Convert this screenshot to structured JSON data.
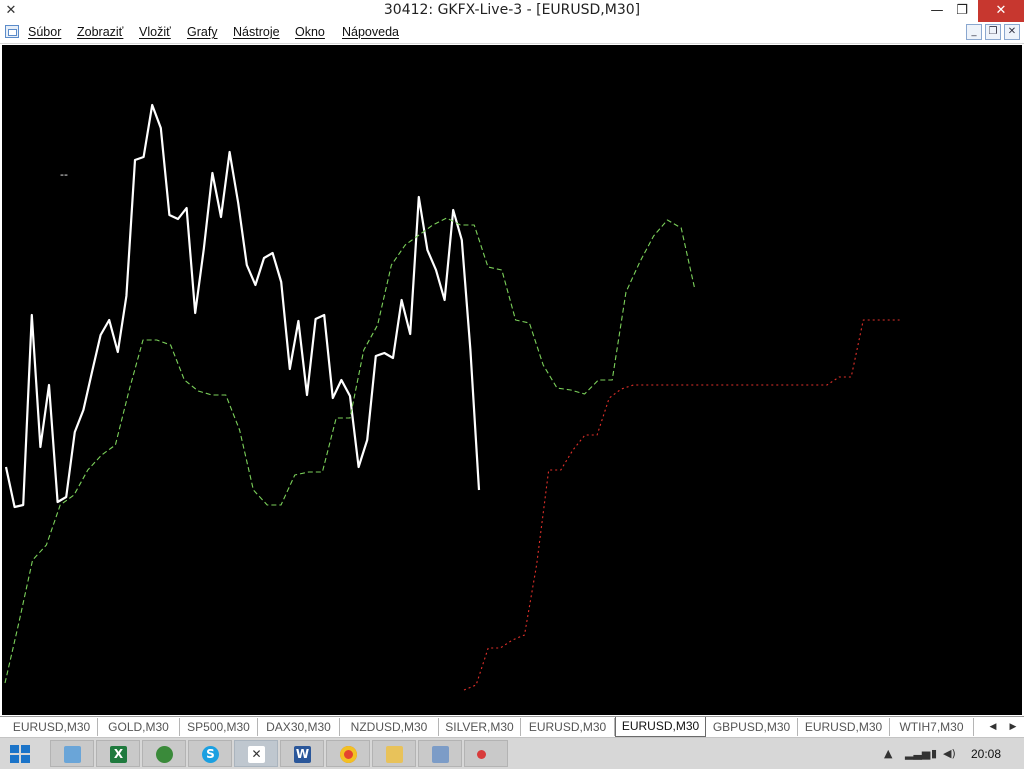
{
  "window": {
    "title": "30412: GKFX-Live-3 - [EURUSD,M30]",
    "minimize_icon": "minimize-icon",
    "maximize_icon": "restore-icon",
    "close_icon": "close-icon"
  },
  "menu": {
    "items": [
      {
        "label": "Súbor"
      },
      {
        "label": "Zobraziť"
      },
      {
        "label": "Vložiť"
      },
      {
        "label": "Grafy"
      },
      {
        "label": "Nástroje"
      },
      {
        "label": "Okno"
      },
      {
        "label": "Nápoveda"
      }
    ]
  },
  "chart": {
    "background": "#000000",
    "colors": {
      "price": "#ffffff",
      "green": "#7bd05a",
      "red": "#e0302a"
    },
    "marker_label": "--"
  },
  "chart_data": {
    "type": "line",
    "series": [
      {
        "style": "solid",
        "color": "#ffffff",
        "values": [
          467,
          507,
          505,
          315,
          447,
          385,
          502,
          497,
          432,
          410,
          372,
          335,
          320,
          352,
          296,
          160,
          157,
          105,
          128,
          215,
          219,
          208,
          313,
          249,
          173,
          217,
          152,
          203,
          265,
          285,
          258,
          253,
          282,
          369,
          321,
          395,
          319,
          315,
          398,
          380,
          396,
          467,
          440,
          356,
          353,
          358,
          300,
          334,
          197,
          250,
          270,
          300,
          210,
          240,
          350,
          490
        ]
      },
      {
        "style": "dashed",
        "color": "#7bd05a",
        "values": [
          683,
          623,
          560,
          545,
          505,
          495,
          470,
          455,
          445,
          390,
          340,
          340,
          345,
          380,
          391,
          395,
          395,
          430,
          490,
          505,
          505,
          475,
          472,
          472,
          418,
          418,
          350,
          325,
          265,
          245,
          235,
          225,
          218,
          225,
          225,
          267,
          270,
          320,
          323,
          365,
          388,
          390,
          394,
          380,
          380,
          292,
          262,
          236,
          220,
          228,
          290
        ]
      },
      {
        "style": "dashed",
        "color": "#e0302a",
        "values": [
          690,
          685,
          648,
          648,
          640,
          635,
          565,
          470,
          470,
          450,
          435,
          435,
          398,
          389,
          385,
          385,
          385,
          385,
          385,
          385,
          385,
          385,
          385,
          385,
          385,
          385,
          385,
          385,
          385,
          385,
          385,
          377,
          377,
          320,
          320,
          320,
          320
        ]
      }
    ]
  },
  "tabs": {
    "items": [
      {
        "label": "EURUSD,M30"
      },
      {
        "label": "GOLD,M30"
      },
      {
        "label": "SP500,M30"
      },
      {
        "label": "DAX30,M30"
      },
      {
        "label": "NZDUSD,M30"
      },
      {
        "label": "SILVER,M30"
      },
      {
        "label": "EURUSD,M30"
      },
      {
        "label": "EURUSD,M30"
      },
      {
        "label": "GBPUSD,M30"
      },
      {
        "label": "EURUSD,M30"
      },
      {
        "label": "WTIH7,M30"
      }
    ],
    "active_index": 7,
    "scroll_left_icon": "chevron-left-icon",
    "scroll_right_icon": "chevron-right-icon"
  },
  "taskbar": {
    "start_icon": "windows-logo-icon",
    "apps": [
      {
        "icon": "app-icon-1"
      },
      {
        "icon": "excel-icon",
        "glyph": "X"
      },
      {
        "icon": "app-icon-3"
      },
      {
        "icon": "skype-icon",
        "glyph": "S"
      },
      {
        "icon": "metatrader-icon"
      },
      {
        "icon": "word-icon",
        "glyph": "W"
      },
      {
        "icon": "chrome-icon"
      },
      {
        "icon": "folder-icon"
      },
      {
        "icon": "app-icon-9"
      },
      {
        "icon": "app-icon-10"
      }
    ],
    "clock": "20:08"
  }
}
